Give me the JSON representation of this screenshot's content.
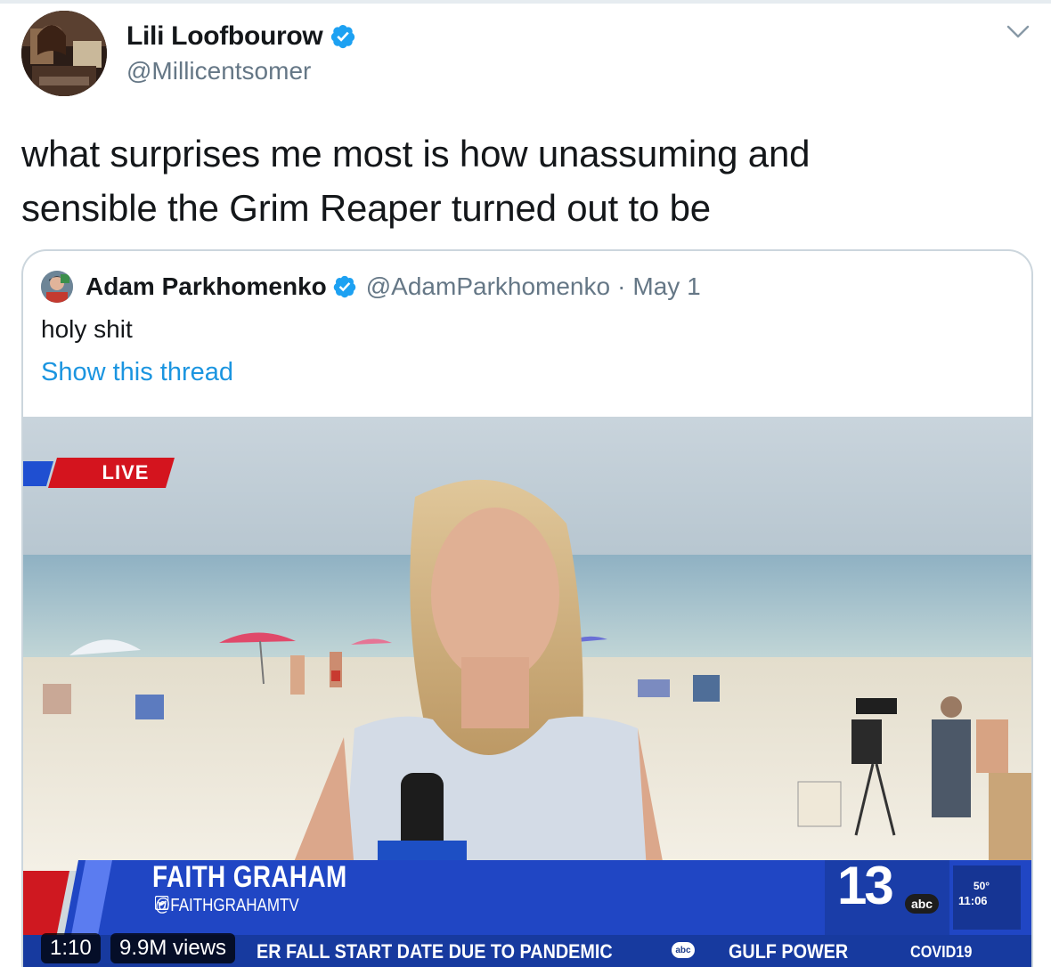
{
  "tweet": {
    "author_name": "Lili Loofbourow",
    "author_handle": "@Millicentsomer",
    "text_line1": "what surprises me most is how unassuming and",
    "text_line2": "sensible the Grim Reaper turned out to be"
  },
  "quoted": {
    "author_name": "Adam Parkhomenko",
    "author_handle": "@AdamParkhomenko",
    "separator": "·",
    "date": "May 1",
    "text": "holy shit",
    "show_thread": "Show this thread",
    "video": {
      "live_label": "LIVE",
      "reporter_name": "FAITH GRAHAM",
      "reporter_twitter": "@FAITHGRAHAMTV",
      "station_number": "13",
      "station_network": "abc",
      "temperature": "50°",
      "clock": "11:06",
      "ticker_main": "ER FALL START DATE DUE TO PANDEMIC",
      "ticker_network": "abc",
      "ticker_secondary": "GULF POWER",
      "ticker_topic": "COVID19",
      "duration": "1:10",
      "views": "9.9M views"
    }
  },
  "colors": {
    "verified_blue": "#1da1f2",
    "link_blue": "#1b95e0",
    "secondary_text": "#657786",
    "news_red": "#d0021b",
    "news_blue": "#1f3fae"
  },
  "icons": [
    "verified-badge-icon",
    "chevron-down-icon",
    "twitter-bird-icon"
  ]
}
